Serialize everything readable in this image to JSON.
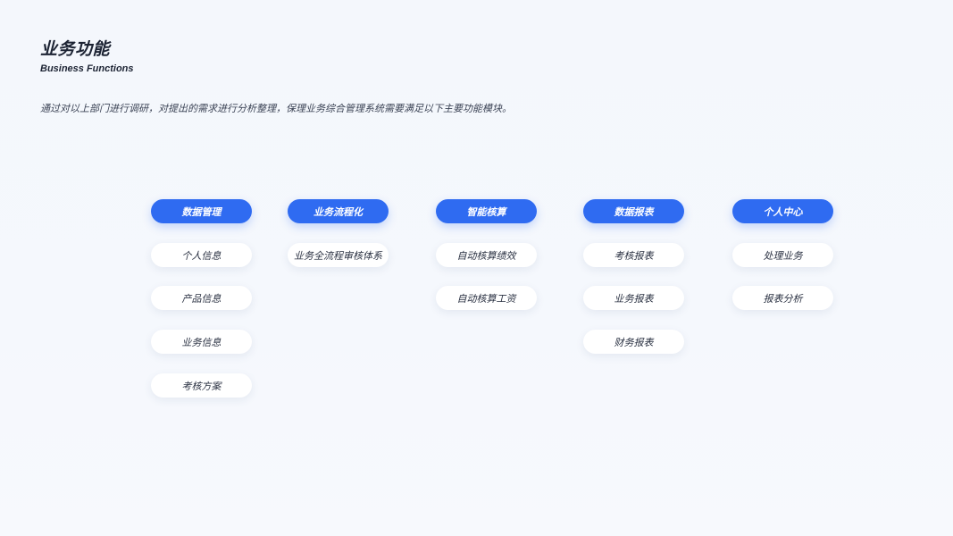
{
  "header": {
    "title": "业务功能",
    "subtitle": "Business Functions"
  },
  "intro": "通过对以上部门进行调研，对提出的需求进行分析整理，保理业务综合管理系统需要满足以下主要功能模块。",
  "colors": {
    "accent": "#2f6bf1",
    "text": "#1c2333",
    "card": "#ffffff"
  },
  "modules": [
    {
      "title": "数据管理",
      "items": [
        "个人信息",
        "产品信息",
        "业务信息",
        "考核方案"
      ]
    },
    {
      "title": "业务流程化",
      "items": [
        "业务全流程审核体系"
      ]
    },
    {
      "title": "智能核算",
      "items": [
        "自动核算绩效",
        "自动核算工资"
      ]
    },
    {
      "title": "数据报表",
      "items": [
        "考核报表",
        "业务报表",
        "财务报表"
      ]
    },
    {
      "title": "个人中心",
      "items": [
        "处理业务",
        "报表分析"
      ]
    }
  ]
}
